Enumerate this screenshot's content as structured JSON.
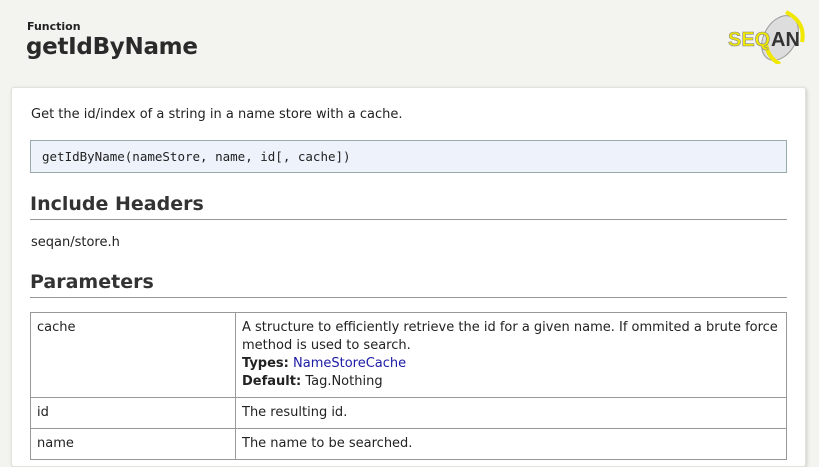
{
  "header": {
    "kind": "Function",
    "title": "getIdByName",
    "logo": "SEQAN"
  },
  "description": "Get the id/index of a string in a name store with a cache.",
  "signature": "getIdByName(nameStore, name, id[, cache])",
  "include": {
    "heading": "Include Headers",
    "file": "seqan/store.h"
  },
  "parameters": {
    "heading": "Parameters",
    "rows": [
      {
        "name": "cache",
        "desc": "A structure to efficiently retrieve the id for a given name. If ommited a brute force method is used to search.",
        "types_label": "Types:",
        "types": "NameStoreCache",
        "default_label": "Default:",
        "default": "Tag.Nothing"
      },
      {
        "name": "id",
        "desc": "The resulting id."
      },
      {
        "name": "name",
        "desc": "The name to be searched."
      }
    ]
  }
}
